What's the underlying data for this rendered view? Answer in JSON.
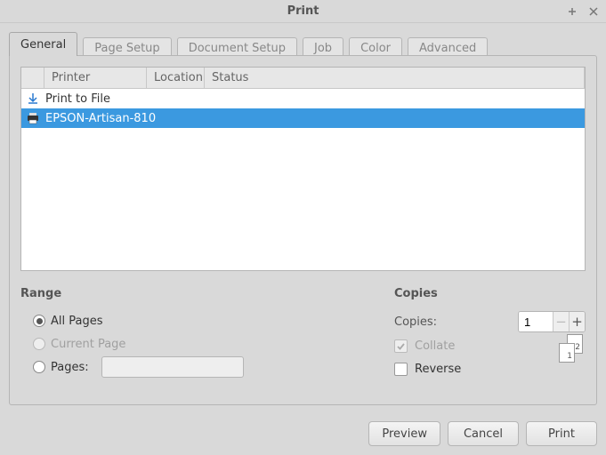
{
  "window": {
    "title": "Print"
  },
  "tabs": [
    {
      "label": "General",
      "active": true
    },
    {
      "label": "Page Setup",
      "active": false
    },
    {
      "label": "Document Setup",
      "active": false
    },
    {
      "label": "Job",
      "active": false
    },
    {
      "label": "Color",
      "active": false
    },
    {
      "label": "Advanced",
      "active": false
    }
  ],
  "columns": {
    "printer": "Printer",
    "location": "Location",
    "status": "Status"
  },
  "printers": [
    {
      "name": "Print to File",
      "icon": "file",
      "selected": false
    },
    {
      "name": "EPSON-Artisan-810",
      "icon": "printer",
      "selected": true
    }
  ],
  "range": {
    "title": "Range",
    "allPages": "All Pages",
    "currentPage": "Current Page",
    "pages": "Pages:",
    "selected": "all",
    "pagesValue": ""
  },
  "copies": {
    "title": "Copies",
    "copiesLabel": "Copies:",
    "copiesValue": "1",
    "collateLabel": "Collate",
    "collateChecked": true,
    "collateEnabled": false,
    "reverseLabel": "Reverse",
    "reverseChecked": false,
    "thumb1": "1",
    "thumb2": "2"
  },
  "buttons": {
    "preview": "Preview",
    "cancel": "Cancel",
    "print": "Print"
  }
}
